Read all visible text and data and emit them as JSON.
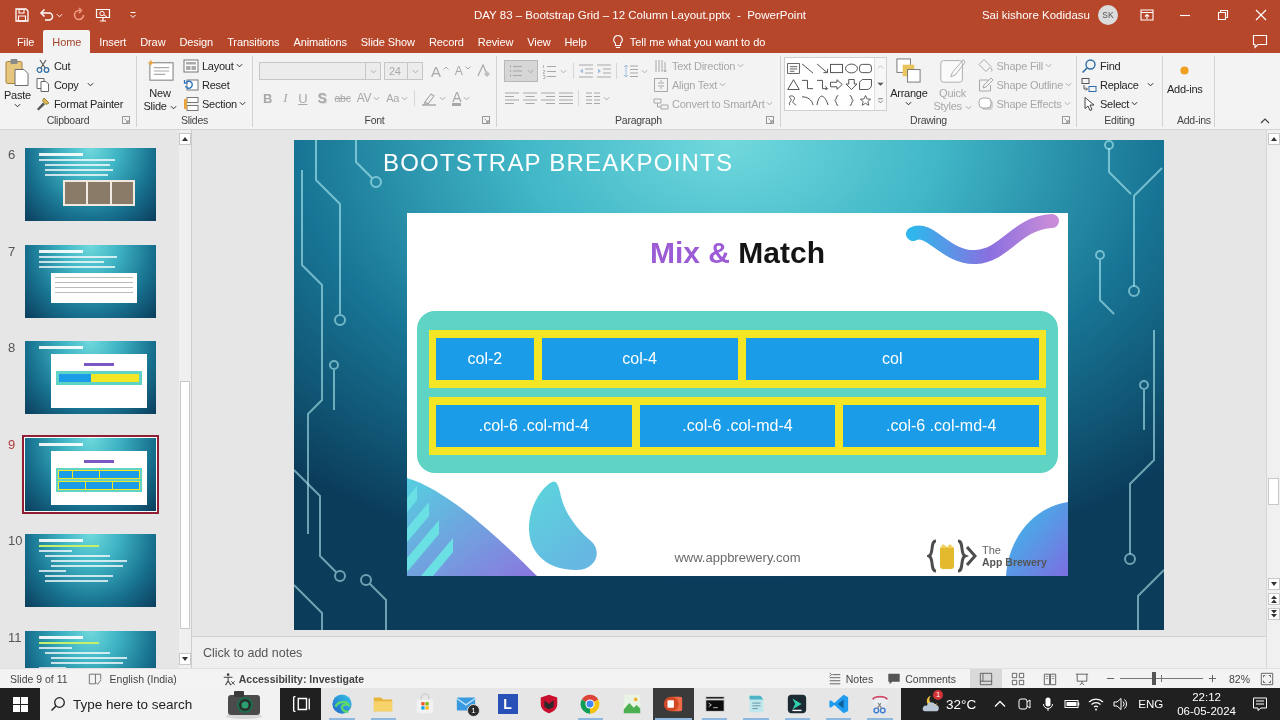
{
  "window": {
    "title": "DAY 83 – Bootstrap Grid – 12 Column Layout.pptx  -  PowerPoint",
    "user": "Sai kishore Kodidasu",
    "avatar": "SK"
  },
  "tabs": [
    {
      "label": "File",
      "selected": false
    },
    {
      "label": "Home",
      "selected": true
    },
    {
      "label": "Insert",
      "selected": false
    },
    {
      "label": "Draw",
      "selected": false
    },
    {
      "label": "Design",
      "selected": false
    },
    {
      "label": "Transitions",
      "selected": false
    },
    {
      "label": "Animations",
      "selected": false
    },
    {
      "label": "Slide Show",
      "selected": false
    },
    {
      "label": "Record",
      "selected": false
    },
    {
      "label": "Review",
      "selected": false
    },
    {
      "label": "View",
      "selected": false
    },
    {
      "label": "Help",
      "selected": false
    }
  ],
  "tell_me": {
    "placeholder": "Tell me what you want to do"
  },
  "ribbon": {
    "clipboard": {
      "label": "Clipboard",
      "paste": "Paste",
      "cut": "Cut",
      "copy": "Copy",
      "format_painter": "Format Painter"
    },
    "slides": {
      "label": "Slides",
      "new_slide": "New Slide",
      "layout": "Layout",
      "reset": "Reset",
      "section": "Section"
    },
    "font": {
      "label": "Font",
      "disabled": true,
      "size": "24",
      "grow": "A",
      "shrink": "A",
      "bold": "B",
      "italic": "I",
      "underline": "U",
      "shadow": "S",
      "strikethrough": "abc",
      "spacing": "AV",
      "change_case": "Aa",
      "font_color": "A"
    },
    "paragraph": {
      "label": "Paragraph",
      "disabled": true,
      "text_direction": "Text Direction",
      "align_text": "Align Text",
      "smartart": "Convert to SmartArt"
    },
    "drawing": {
      "label": "Drawing",
      "buttons": [
        {
          "label": "Arrange",
          "disabled": false
        },
        {
          "label": "Quick Styles",
          "disabled": true
        },
        {
          "label": "Shape Fill",
          "disabled": true
        },
        {
          "label": "Shape Outline",
          "disabled": true
        },
        {
          "label": "Shape Effects",
          "disabled": true
        }
      ]
    },
    "editing": {
      "label": "Editing",
      "find": "Find",
      "replace": "Replace",
      "select": "Select"
    },
    "addins": {
      "label": "Add-ins",
      "button": "Add-ins"
    }
  },
  "thumbnails": [
    {
      "number": "6",
      "kind": "photo",
      "selected": false
    },
    {
      "number": "7",
      "kind": "table",
      "selected": false
    },
    {
      "number": "8",
      "kind": "bar",
      "selected": false
    },
    {
      "number": "9",
      "kind": "grid",
      "selected": true
    },
    {
      "number": "10",
      "kind": "code",
      "selected": false
    },
    {
      "number": "11",
      "kind": "code",
      "selected": false
    }
  ],
  "slide": {
    "title": "BOOTSTRAP BREAKPOINTS",
    "heading": [
      {
        "text": "Mix &",
        "color": "#9b5cd6"
      },
      {
        "text": "Match",
        "color": "#141414"
      }
    ],
    "rows": [
      {
        "kind": "mixed",
        "columns": [
          "col-2",
          "col-4",
          "col"
        ]
      },
      {
        "kind": "equal",
        "columns": [
          ".col-6 .col-md-4",
          ".col-6 .col-md-4",
          ".col-6 .col-md-4"
        ]
      }
    ],
    "website": "www.appbrewery.com",
    "logo": {
      "line_1": "The",
      "line_2": "App Brewery"
    }
  },
  "notes": {
    "placeholder": "Click to add notes"
  },
  "status_bar": {
    "slide": "Slide 9 of 11",
    "language": "English (India)",
    "accessibility": "Accessibility: Investigate",
    "notes": "Notes",
    "comments": "Comments",
    "views": [
      {
        "selected": true
      },
      {
        "selected": false
      },
      {
        "selected": false
      },
      {
        "selected": false
      }
    ],
    "zoom": {
      "level": 0.41,
      "reading": "82%"
    }
  },
  "taskbar": {
    "search": {
      "placeholder": "Type here to search"
    },
    "apps": [
      {
        "kind": "edge",
        "running": true,
        "selected": false
      },
      {
        "kind": "folder",
        "running": true,
        "selected": false
      },
      {
        "kind": "store",
        "running": false,
        "selected": false
      },
      {
        "kind": "mail",
        "running": false,
        "selected": false,
        "badge": "1"
      },
      {
        "kind": "letter",
        "running": false,
        "selected": false,
        "glyph": "L"
      },
      {
        "kind": "shield",
        "running": false,
        "selected": false
      },
      {
        "kind": "chrome",
        "running": true,
        "selected": false
      },
      {
        "kind": "picture",
        "running": false,
        "selected": false
      },
      {
        "kind": "slides",
        "running": true,
        "selected": true
      },
      {
        "kind": "terminal",
        "running": true,
        "selected": false
      },
      {
        "kind": "notepad",
        "running": true,
        "selected": false
      },
      {
        "kind": "cursor",
        "running": true,
        "selected": false
      },
      {
        "kind": "code",
        "running": true,
        "selected": false
      },
      {
        "kind": "scissors",
        "running": true,
        "selected": false
      }
    ],
    "weather": {
      "temperature": "32°C",
      "badge": "1"
    },
    "language": "ENG",
    "time": "22:12",
    "date": "06-05-2024"
  }
}
